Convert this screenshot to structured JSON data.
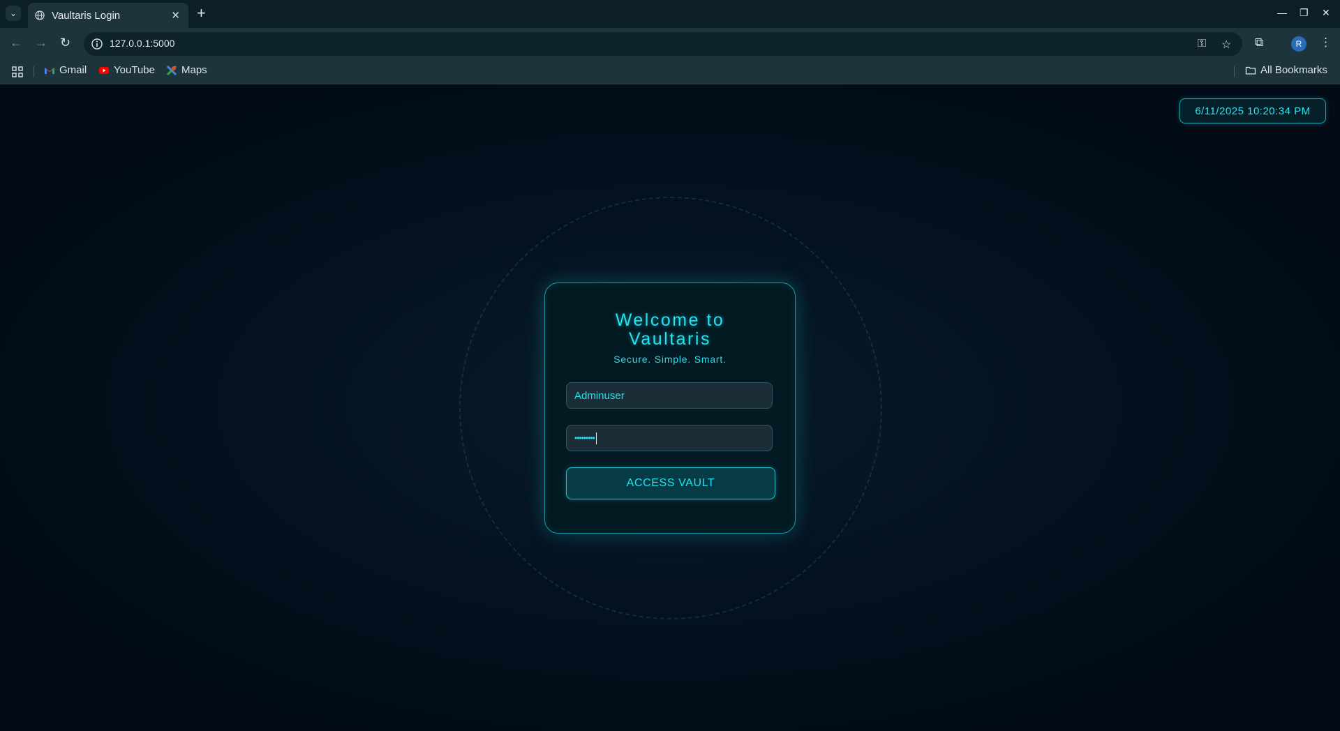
{
  "browser": {
    "tab_title": "Vaultaris Login",
    "tab_close": "✕",
    "new_tab": "+",
    "url": "127.0.0.1:5000",
    "bookmarks": [
      {
        "label": "Gmail",
        "icon": "gmail-icon"
      },
      {
        "label": "YouTube",
        "icon": "youtube-icon"
      },
      {
        "label": "Maps",
        "icon": "maps-icon"
      }
    ],
    "all_bookmarks": "All Bookmarks",
    "profile_initial": "R"
  },
  "page": {
    "clock": "6/11/2025 10:20:34 PM",
    "title_line1": "Welcome to",
    "title_line2": "Vaultaris",
    "tagline": "Secure. Simple. Smart.",
    "username_value": "Adminuser",
    "password_mask": "•••••••••",
    "submit_label": "ACCESS VAULT"
  },
  "colors": {
    "accent": "#22e3f0",
    "background": "#020b16",
    "card_border": "#1b97a3"
  }
}
